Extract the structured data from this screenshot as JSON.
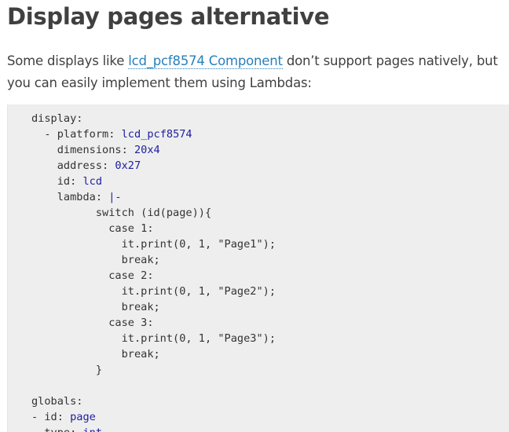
{
  "heading": "Display pages alternative",
  "intro": {
    "before": "Some displays like ",
    "link": "lcd_pcf8574 Component",
    "after": " don’t support pages natively, but you can easily implement them using Lambdas:"
  },
  "code_lines": [
    [
      {
        "t": "display:",
        "c": "key"
      }
    ],
    [
      {
        "t": "  - ",
        "c": "punc"
      },
      {
        "t": "platform: ",
        "c": "key"
      },
      {
        "t": "lcd_pcf8574",
        "c": "val"
      }
    ],
    [
      {
        "t": "    dimensions: ",
        "c": "key"
      },
      {
        "t": "20x4",
        "c": "val"
      }
    ],
    [
      {
        "t": "    address: ",
        "c": "key"
      },
      {
        "t": "0x27",
        "c": "val"
      }
    ],
    [
      {
        "t": "    id: ",
        "c": "key"
      },
      {
        "t": "lcd",
        "c": "val"
      }
    ],
    [
      {
        "t": "    lambda: ",
        "c": "key"
      },
      {
        "t": "|-",
        "c": "val"
      }
    ],
    [
      {
        "t": "          switch (id(page)){",
        "c": "str"
      }
    ],
    [
      {
        "t": "            case 1:",
        "c": "str"
      }
    ],
    [
      {
        "t": "              it.print(0, 1, \"Page1\");",
        "c": "str"
      }
    ],
    [
      {
        "t": "              break;",
        "c": "str"
      }
    ],
    [
      {
        "t": "            case 2:",
        "c": "str"
      }
    ],
    [
      {
        "t": "              it.print(0, 1, \"Page2\");",
        "c": "str"
      }
    ],
    [
      {
        "t": "              break;",
        "c": "str"
      }
    ],
    [
      {
        "t": "            case 3:",
        "c": "str"
      }
    ],
    [
      {
        "t": "              it.print(0, 1, \"Page3\");",
        "c": "str"
      }
    ],
    [
      {
        "t": "              break;",
        "c": "str"
      }
    ],
    [
      {
        "t": "          }",
        "c": "str"
      }
    ],
    [],
    [
      {
        "t": "globals:",
        "c": "key"
      }
    ],
    [
      {
        "t": "- ",
        "c": "punc"
      },
      {
        "t": "id: ",
        "c": "key"
      },
      {
        "t": "page",
        "c": "val"
      }
    ],
    [
      {
        "t": "  type: ",
        "c": "key"
      },
      {
        "t": "int",
        "c": "val"
      }
    ]
  ]
}
